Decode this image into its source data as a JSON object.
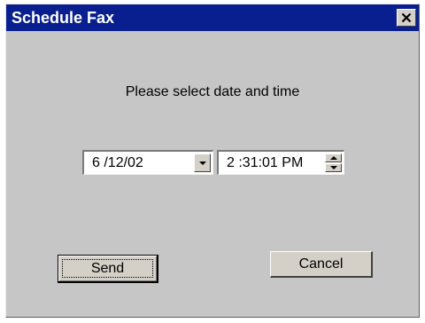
{
  "window": {
    "title": "Schedule Fax",
    "title_bar_color": "#0a1f8f",
    "background_color": "#c6c6c6",
    "close_icon": "close-icon"
  },
  "content": {
    "prompt": "Please select date and time"
  },
  "date_picker": {
    "value": "6 /12/02",
    "icon": "chevron-down-icon"
  },
  "time_picker": {
    "value": "2 :31:01 PM",
    "icons": [
      "spin-up-icon",
      "spin-down-icon"
    ]
  },
  "buttons": {
    "send_label": "Send",
    "cancel_label": "Cancel"
  }
}
